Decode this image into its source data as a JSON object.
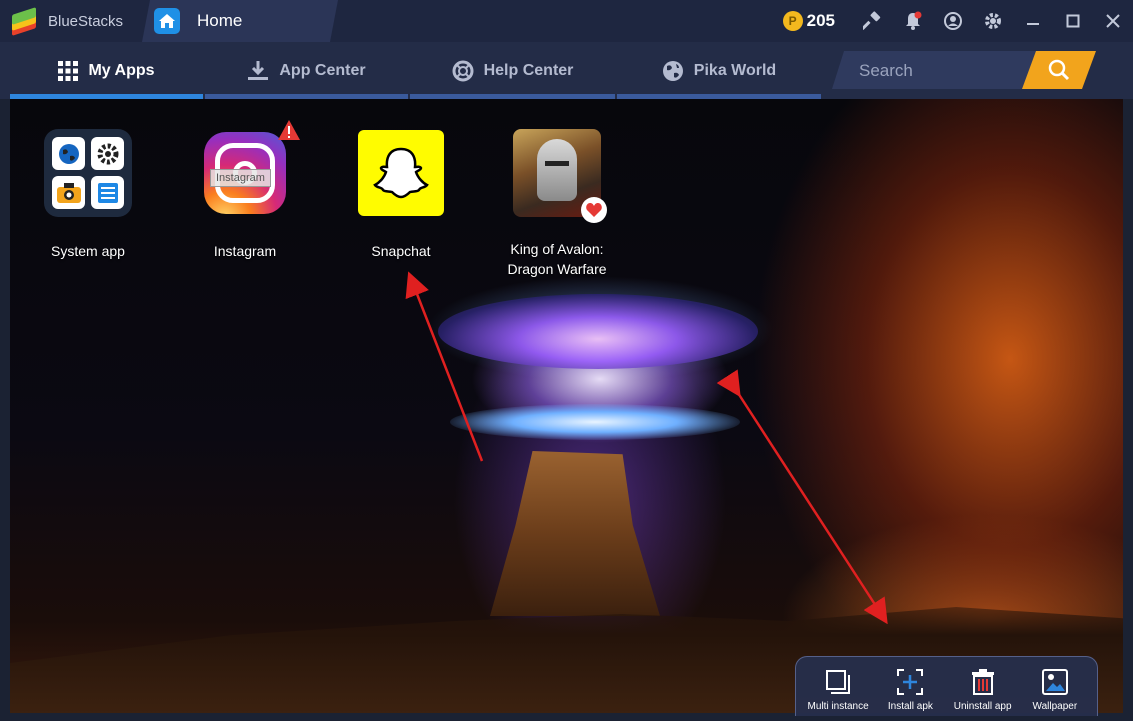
{
  "window": {
    "app_name": "BlueStacks",
    "tab_title": "Home",
    "coins": "205",
    "coin_symbol": "P"
  },
  "nav": {
    "tabs": [
      {
        "label": "My Apps",
        "icon": "grid-icon",
        "active": true
      },
      {
        "label": "App Center",
        "icon": "download-icon",
        "active": false
      },
      {
        "label": "Help Center",
        "icon": "lifebuoy-icon",
        "active": false
      },
      {
        "label": "Pika World",
        "icon": "globe-icon",
        "active": false
      }
    ],
    "search_placeholder": "Search"
  },
  "apps": [
    {
      "label": "System app",
      "icon": "system-app-icon"
    },
    {
      "label": "Instagram",
      "icon": "instagram-icon",
      "tooltip": "Instagram",
      "warning": true
    },
    {
      "label": "Snapchat",
      "icon": "snapchat-icon"
    },
    {
      "label": "King of Avalon: Dragon Warfare",
      "icon": "king-of-avalon-icon",
      "favorite": true
    }
  ],
  "toolbar": {
    "items": [
      {
        "label": "Multi instance",
        "icon": "multi-instance-icon"
      },
      {
        "label": "Install apk",
        "icon": "install-apk-icon"
      },
      {
        "label": "Uninstall app",
        "icon": "trash-icon"
      },
      {
        "label": "Wallpaper",
        "icon": "wallpaper-icon"
      }
    ]
  },
  "colors": {
    "titlebar": "#1e2640",
    "navbar": "#232c47",
    "accent_blue": "#2e86de",
    "search_button": "#f2a41c",
    "annotation_arrow": "#e02020"
  }
}
